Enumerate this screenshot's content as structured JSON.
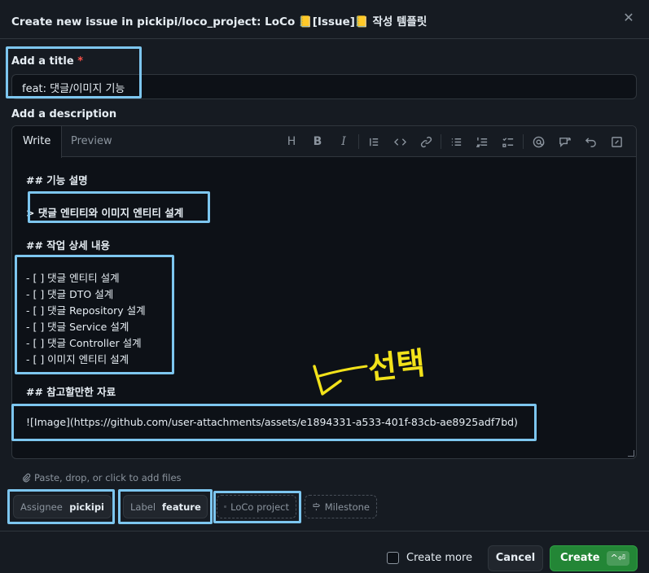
{
  "header": {
    "title": "Create new issue in pickipi/loco_project: LoCo 📒[Issue]📒 작성 템플릿",
    "close_symbol": "✕"
  },
  "title_field": {
    "label": "Add a title",
    "required_mark": "*",
    "value": "feat: 댓글/이미지 기능"
  },
  "description": {
    "label": "Add a description",
    "tabs": [
      "Write",
      "Preview"
    ],
    "toolbar_icons": [
      "heading-icon",
      "bold-icon",
      "italic-icon",
      "quote-icon",
      "code-icon",
      "link-icon",
      "bullet-list-icon",
      "numbered-list-icon",
      "task-list-icon",
      "mention-icon",
      "reference-icon",
      "undo-icon",
      "fullscreen-icon"
    ],
    "lines": {
      "h1": "## 기능 설명",
      "quote": "> 댓글 엔티티와 이미지 엔티티 설계",
      "h2": "## 작업 상세 내용",
      "tasks": [
        "- [ ] 댓글 엔티티 설계",
        "- [ ] 댓글 DTO 설계",
        "- [ ] 댓글 Repository 설계",
        "- [ ] 댓글 Service 설계",
        "- [ ] 댓글 Controller 설계",
        "- [ ] 이미지 엔티티 설계"
      ],
      "h3": "## 참고할만한 자료",
      "image_link": "![Image](https://github.com/user-attachments/assets/e1894331-a533-401f-83cb-ae8925adf7bd)"
    },
    "attach_hint": "Paste, drop, or click to add files"
  },
  "metadata": {
    "assignee_label": "Assignee",
    "assignee_value": "pickipi",
    "label_label": "Label",
    "label_value": "feature",
    "project_value": "LoCo project",
    "milestone_label": "Milestone"
  },
  "annotation_text": "선택",
  "footer": {
    "create_more": "Create more",
    "cancel": "Cancel",
    "create": "Create",
    "shortcut": "^⏎"
  },
  "colors": {
    "highlight": "#7dc6ef",
    "annotation": "#f2e21a",
    "create_button": "#238636"
  }
}
